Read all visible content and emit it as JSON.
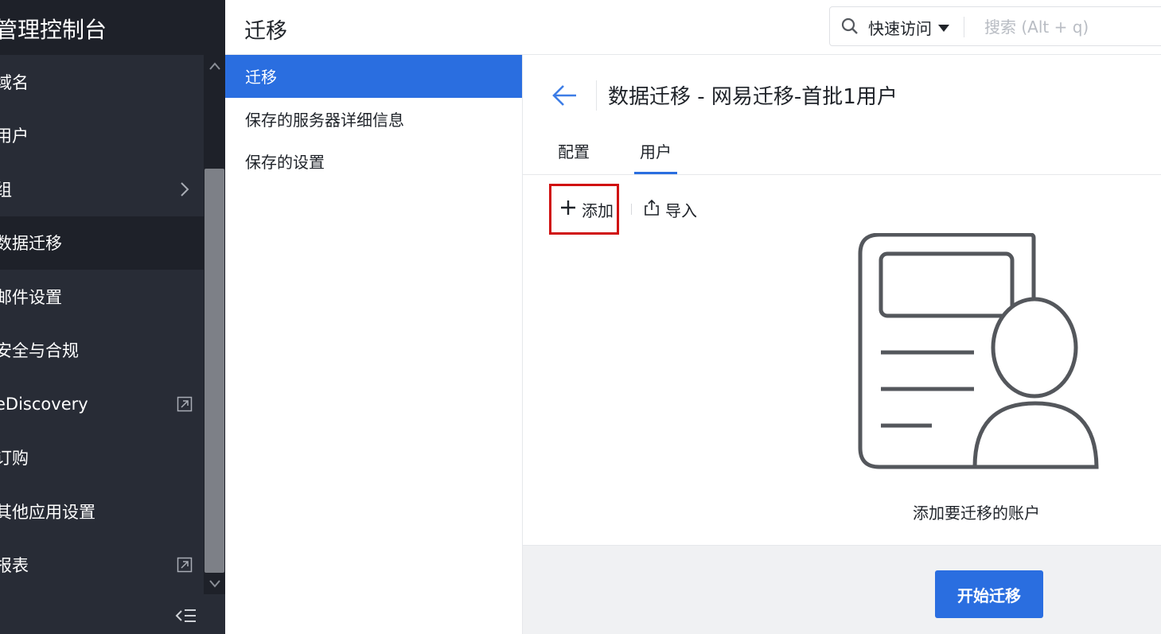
{
  "app": {
    "title": "管理控制台"
  },
  "sidebar": {
    "items": [
      {
        "label": "域名",
        "suffix": ""
      },
      {
        "label": "用户",
        "suffix": ""
      },
      {
        "label": "组",
        "suffix": "chevron-right-icon"
      },
      {
        "label": "数据迁移",
        "suffix": "",
        "active": true
      },
      {
        "label": "邮件设置",
        "suffix": ""
      },
      {
        "label": "安全与合规",
        "suffix": ""
      },
      {
        "label": "eDiscovery",
        "suffix": "external-link-icon"
      },
      {
        "label": "订购",
        "suffix": ""
      },
      {
        "label": "其他应用设置",
        "suffix": ""
      },
      {
        "label": "报表",
        "suffix": "external-link-icon"
      }
    ]
  },
  "header": {
    "title": "迁移",
    "quick_access": "快速访问",
    "search_placeholder": "搜索 (Alt + q)"
  },
  "subnav": {
    "items": [
      {
        "label": "迁移",
        "active": true
      },
      {
        "label": "保存的服务器详细信息",
        "active": false
      },
      {
        "label": "保存的设置",
        "active": false
      }
    ]
  },
  "main": {
    "title": "数据迁移 - 网易迁移-首批1用户",
    "tabs": [
      {
        "label": "配置",
        "active": false
      },
      {
        "label": "用户",
        "active": true
      }
    ],
    "toolbar": {
      "add_label": "添加",
      "import_label": "导入"
    },
    "empty_text": "添加要迁移的账户",
    "start_button": "开始迁移"
  },
  "colors": {
    "accent": "#2a6ee0",
    "sidebar_bg": "#282c36",
    "highlight_box": "#d01010"
  }
}
